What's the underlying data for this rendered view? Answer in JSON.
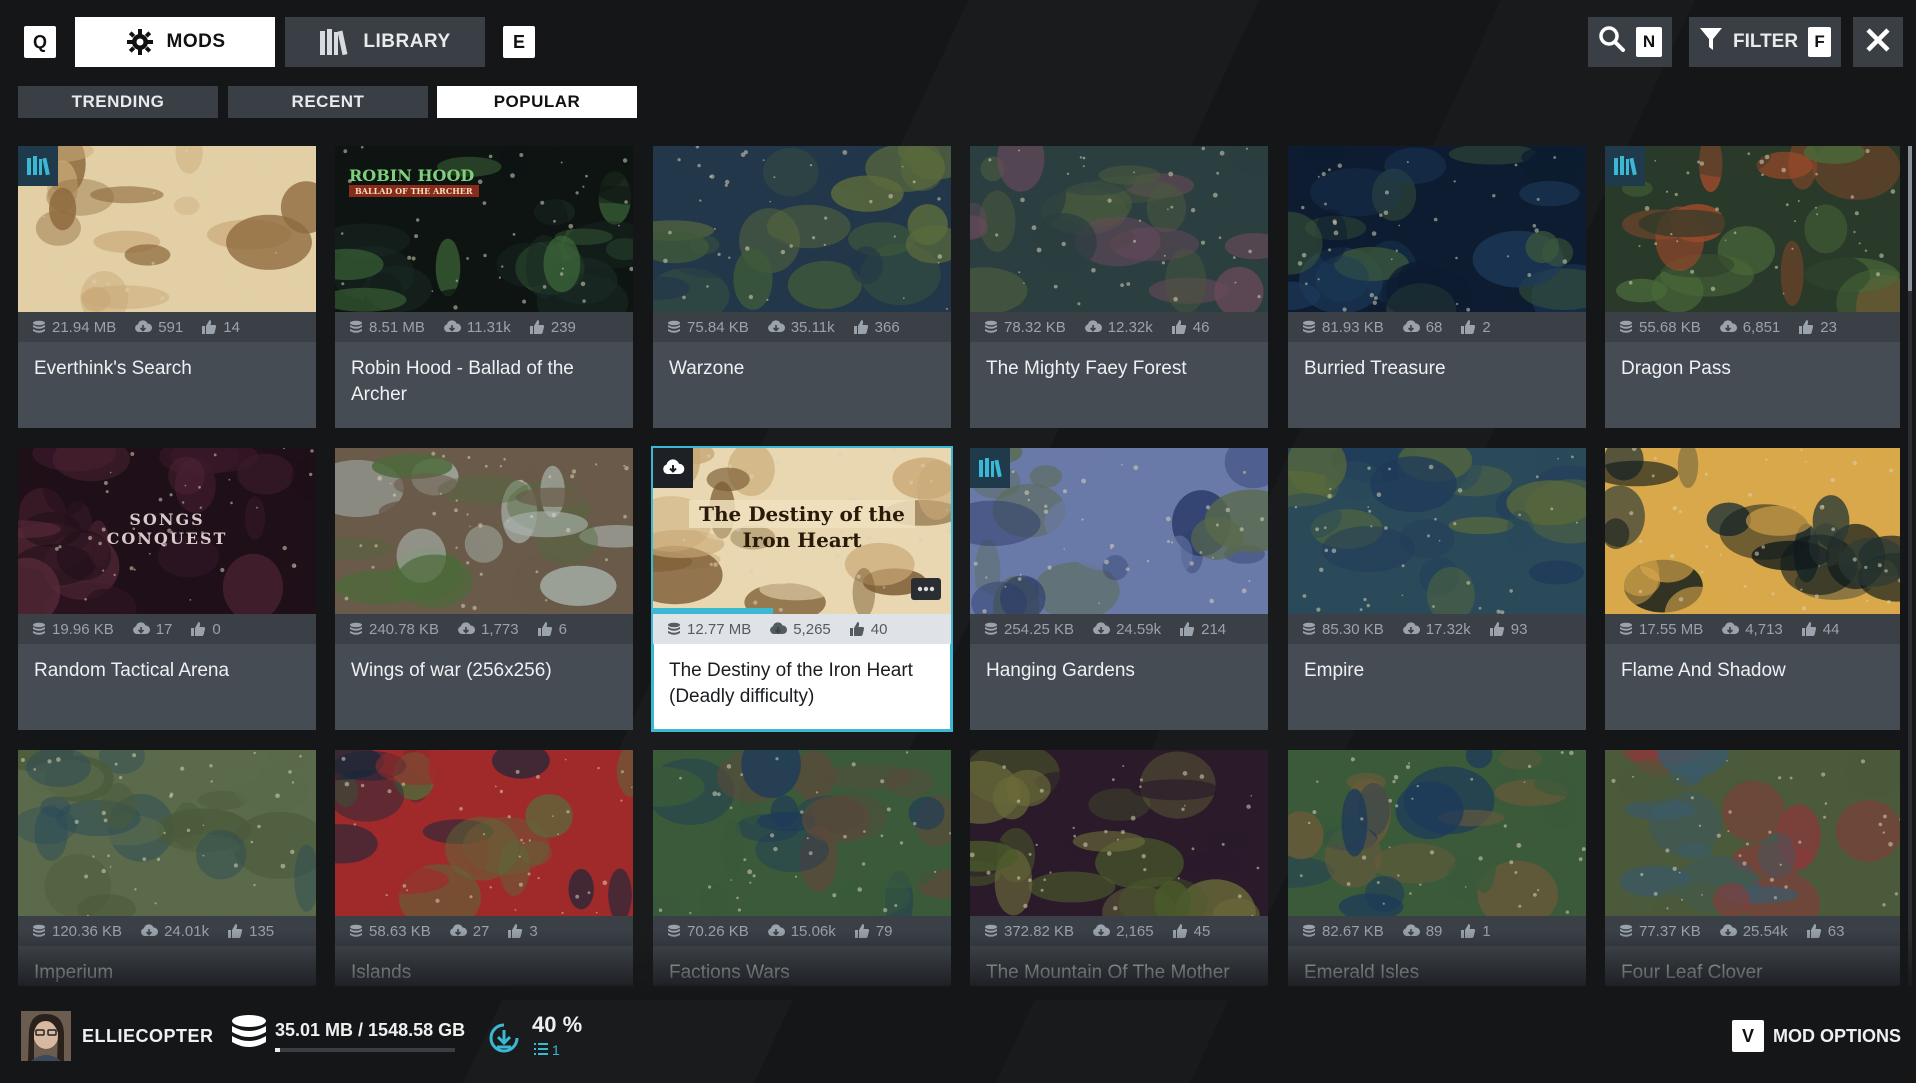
{
  "nav": {
    "left_key": "Q",
    "right_key": "E",
    "tabs": [
      {
        "label": "MODS",
        "icon": "gear-icon",
        "active": true
      },
      {
        "label": "LIBRARY",
        "icon": "library-books-icon",
        "active": false
      }
    ],
    "search_key": "N",
    "filter_label": "FILTER",
    "filter_key": "F"
  },
  "subtabs": [
    {
      "label": "TRENDING",
      "active": false
    },
    {
      "label": "RECENT",
      "active": false
    },
    {
      "label": "POPULAR",
      "active": true
    }
  ],
  "mods": [
    {
      "title": "Everthink's Search",
      "size": "21.94 MB",
      "downloads": "591",
      "likes": "14",
      "in_library": true,
      "palette": [
        "#c9a877",
        "#8e6a3e",
        "#e2cfa5"
      ]
    },
    {
      "title": "Robin Hood - Ballad of the Archer",
      "size": "8.51 MB",
      "downloads": "11.31k",
      "likes": "239",
      "palette": [
        "#1a2a24",
        "#3f6a3a",
        "#0e1412"
      ],
      "banner": "ROBIN HOOD",
      "banner_sub": "BALLAD OF THE ARCHER"
    },
    {
      "title": "Warzone",
      "size": "75.84 KB",
      "downloads": "35.11k",
      "likes": "366",
      "palette": [
        "#3e5a3a",
        "#5c6b3c",
        "#22374a"
      ]
    },
    {
      "title": "The Mighty Faey Forest",
      "size": "78.32 KB",
      "downloads": "12.32k",
      "likes": "46",
      "palette": [
        "#4a5a3e",
        "#6a4a5a",
        "#2b3e40"
      ]
    },
    {
      "title": "Burried Treasure",
      "size": "81.93 KB",
      "downloads": "68",
      "likes": "2",
      "palette": [
        "#1d3a5a",
        "#3e5a3a",
        "#0d1c30"
      ]
    },
    {
      "title": "Dragon Pass",
      "size": "55.68 KB",
      "downloads": "6,851",
      "likes": "23",
      "in_library": true,
      "palette": [
        "#4a6a3a",
        "#a04a2a",
        "#2a3a2a"
      ]
    },
    {
      "title": "Random Tactical Arena",
      "size": "19.96 KB",
      "downloads": "17",
      "likes": "0",
      "palette": [
        "#3a1a2a",
        "#5a2a3a",
        "#1f0f18"
      ],
      "banner": "SONGS",
      "banner_sub": "CONQUEST"
    },
    {
      "title": "Wings of war (256x256)",
      "size": "240.78 KB",
      "downloads": "1,773",
      "likes": "6",
      "palette": [
        "#a9b3ad",
        "#4e6a3a",
        "#6a5a4a"
      ]
    },
    {
      "title": "The Destiny of the Iron Heart (Deadly difficulty)",
      "size": "12.77 MB",
      "downloads": "5,265",
      "likes": "40",
      "selected": true,
      "downloading": true,
      "palette": [
        "#c9a877",
        "#7a5a32",
        "#e8d7b0"
      ],
      "banner": "The Destiny of the",
      "banner_sub": "Iron Heart"
    },
    {
      "title": "Hanging Gardens",
      "size": "254.25 KB",
      "downloads": "24.59k",
      "likes": "214",
      "in_library": true,
      "palette": [
        "#2a3a6a",
        "#5a6a4a",
        "#6a7aa8"
      ]
    },
    {
      "title": "Empire",
      "size": "85.30 KB",
      "downloads": "17.32k",
      "likes": "93",
      "palette": [
        "#1f3a5a",
        "#5a6a3a",
        "#2a4a5a"
      ]
    },
    {
      "title": "Flame And Shadow",
      "size": "17.55 MB",
      "downloads": "4,713",
      "likes": "44",
      "palette": [
        "#0f1a1c",
        "#2a3a38",
        "#d9a84a"
      ]
    },
    {
      "title": "Imperium",
      "size": "120.36 KB",
      "downloads": "24.01k",
      "likes": "135",
      "palette": [
        "#2a4a5a",
        "#4a5a3a",
        "#5a6a4a"
      ]
    },
    {
      "title": "Islands",
      "size": "58.63 KB",
      "downloads": "27",
      "likes": "3",
      "palette": [
        "#15283a",
        "#5a6a3a",
        "#a02a2a"
      ]
    },
    {
      "title": "Factions Wars",
      "size": "70.26 KB",
      "downloads": "15.06k",
      "likes": "79",
      "palette": [
        "#1d3a5a",
        "#5a4a3a",
        "#3a5a3a"
      ]
    },
    {
      "title": "The Mountain Of The Mother",
      "size": "372.82 KB",
      "downloads": "2,165",
      "likes": "45",
      "palette": [
        "#4a5a2a",
        "#6a6a3a",
        "#2a1a2a"
      ]
    },
    {
      "title": "Emerald Isles",
      "size": "82.67 KB",
      "downloads": "89",
      "likes": "1",
      "palette": [
        "#1d3a5a",
        "#6a5a3a",
        "#3a5a3a"
      ]
    },
    {
      "title": "Four Leaf Clover",
      "size": "77.37 KB",
      "downloads": "25.54k",
      "likes": "63",
      "palette": [
        "#3a5a6a",
        "#8a3a3a",
        "#4a5a3a"
      ]
    }
  ],
  "footer": {
    "username": "ELLIECOPTER",
    "storage": "35.01 MB / 1548.58 GB",
    "storage_fraction": 0.03,
    "download_percent": "40 %",
    "queue_count": "1",
    "mod_options_key": "V",
    "mod_options_label": "MOD OPTIONS"
  },
  "colors": {
    "accent": "#3ab8d4",
    "card": "#464c54",
    "background": "#141618"
  }
}
